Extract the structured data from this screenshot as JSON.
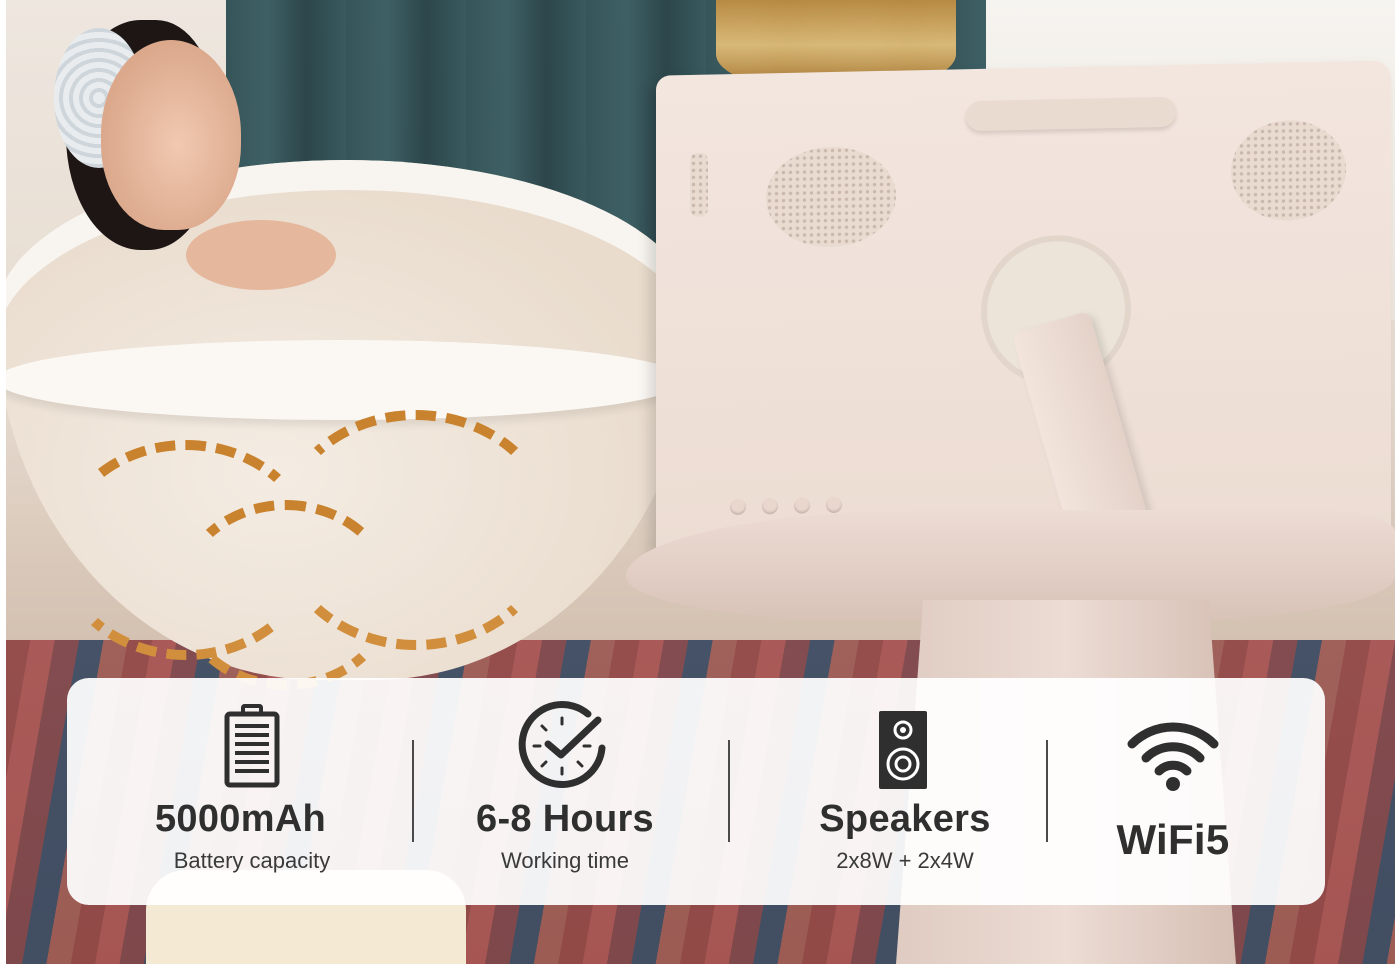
{
  "features": [
    {
      "icon": "battery-icon",
      "title": "5000mAh",
      "subtitle": "Battery capacity"
    },
    {
      "icon": "clock-icon",
      "title": "6-8 Hours",
      "subtitle": "Working time"
    },
    {
      "icon": "speaker-icon",
      "title": "Speakers",
      "subtitle": "2x8W + 2x4W"
    },
    {
      "icon": "wifi-icon",
      "title": "WiFi5",
      "subtitle": ""
    }
  ],
  "colors": {
    "icon": "#2f2f2f",
    "text": "#333333",
    "panel": "#ffffff"
  }
}
